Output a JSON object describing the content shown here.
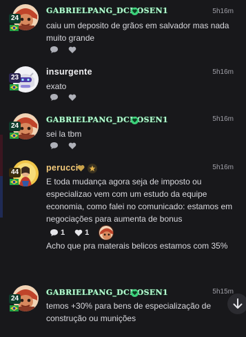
{
  "messages": [
    {
      "level": "24",
      "username": "GABRIELPANG_DCHOSEN1",
      "time": "5h16m",
      "text": "caiu um deposito de grãos em salvador mas nada muito grande",
      "avatar": "cartoon-face-avatar"
    },
    {
      "level": "23",
      "username": "insurgente",
      "time": "5h16m",
      "text": "exato",
      "avatar": "white-robot-avatar"
    },
    {
      "level": "24",
      "username": "GABRIELPANG_DCHOSEN1",
      "time": "5h16m",
      "text": "sei la tbm",
      "avatar": "cartoon-face-avatar"
    },
    {
      "level": "44",
      "username": "perucci",
      "time": "5h16m",
      "text": "E toda mudança agora seja de imposto ou especializao vem com um estudo da equipe economia, como falei no comunicado: estamos em negociações para aumenta de bonus",
      "reply_count": "1",
      "like_count": "1",
      "followup_text": "Acho que pra materais belicos estamos com 35%",
      "avatar": "religious-painting-avatar"
    },
    {
      "level": "24",
      "username": "GABRIELPANG_DCHOSEN1",
      "time": "5h15m",
      "text": "temos +30% para bens de especialização de construção ou munições",
      "avatar": "cartoon-face-avatar"
    }
  ],
  "icons": {
    "reply": "comment-icon",
    "like": "heart-icon",
    "scroll": "arrow-down-icon",
    "flag": "brazil-flag-icon",
    "badge": "green-heart-badge-icon"
  },
  "colors": {
    "background": "#18181b",
    "username_green": "#a7f2c4",
    "heart_green": "#3ad27a",
    "text": "#d9d9de",
    "time": "#a0a0a8"
  }
}
